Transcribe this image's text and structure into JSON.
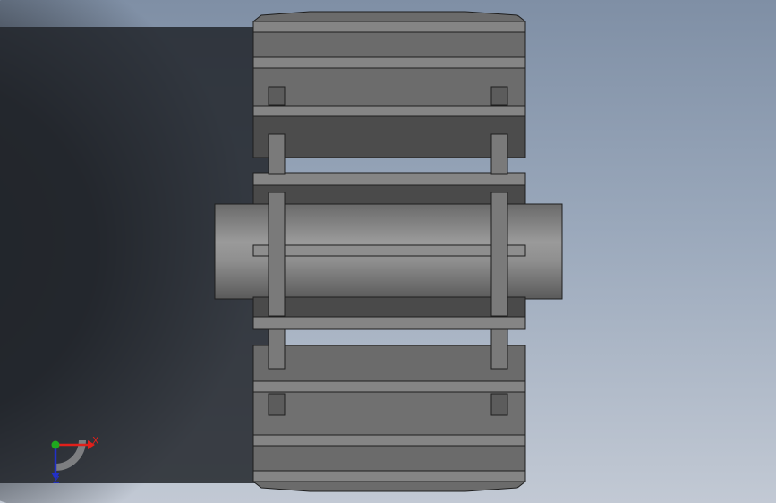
{
  "triad": {
    "x_label": "X",
    "y_label": "Y",
    "z_label": "Z",
    "x_color": "#e0201b",
    "y_color": "#1fa81f",
    "z_color": "#2230c8"
  },
  "model": {
    "body_color": "#6e6e6e",
    "dark_color": "#4a4a4a",
    "light_color": "#8c8c8c",
    "edge_color": "#1e1e1e"
  },
  "background": {
    "top_color": "#7f8fa5",
    "bottom_color": "#c2c9d4",
    "shadow_color": "#23272c"
  }
}
